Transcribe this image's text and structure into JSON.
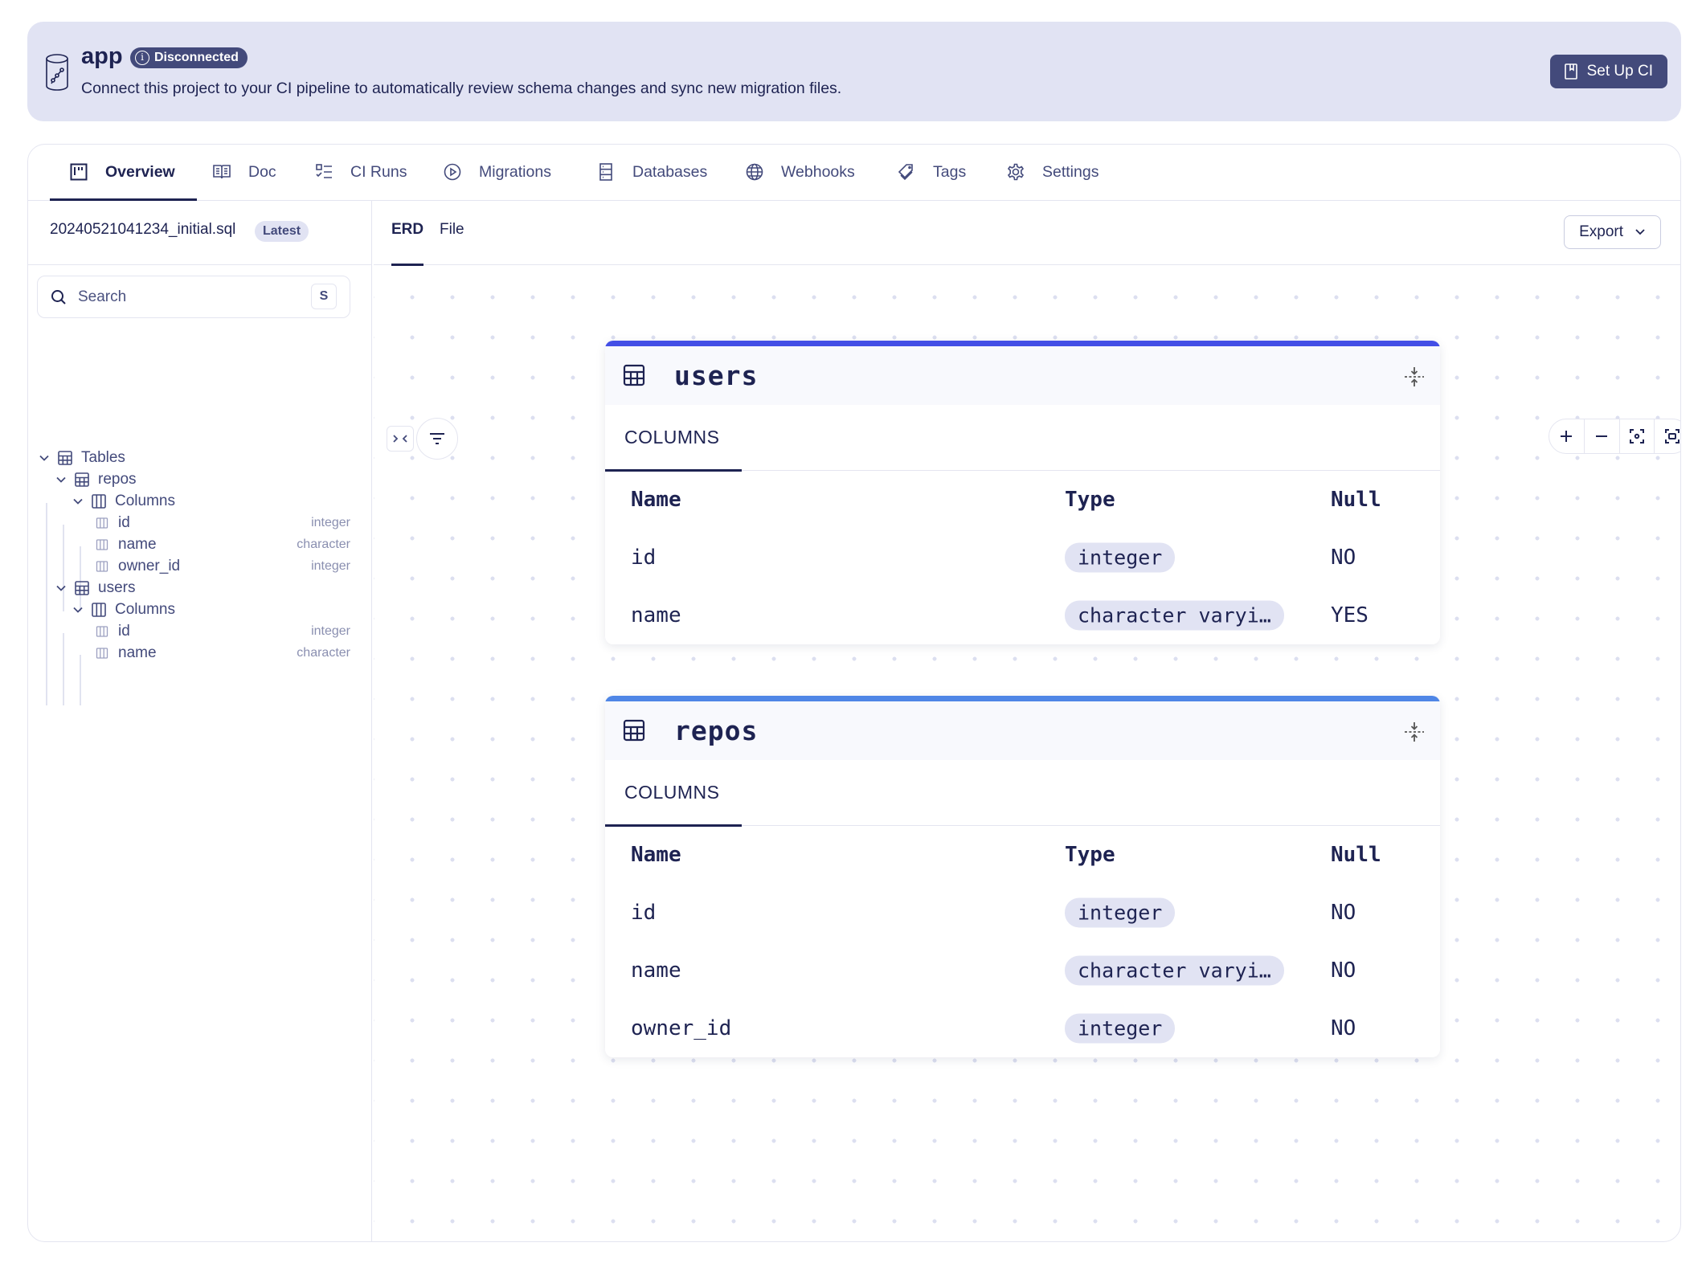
{
  "banner": {
    "project_name": "app",
    "status": "Disconnected",
    "description": "Connect this project to your CI pipeline to automatically review schema changes and sync new migration files.",
    "setup_button": "Set Up CI"
  },
  "tabs": [
    {
      "label": "Overview",
      "icon": "kanban-icon",
      "active": true
    },
    {
      "label": "Doc",
      "icon": "book-open-icon",
      "active": false
    },
    {
      "label": "CI Runs",
      "icon": "list-checks-icon",
      "active": false
    },
    {
      "label": "Migrations",
      "icon": "play-circle-icon",
      "active": false
    },
    {
      "label": "Databases",
      "icon": "server-icon",
      "active": false
    },
    {
      "label": "Webhooks",
      "icon": "globe-icon",
      "active": false
    },
    {
      "label": "Tags",
      "icon": "tags-icon",
      "active": false
    },
    {
      "label": "Settings",
      "icon": "gear-icon",
      "active": false
    }
  ],
  "sidebar": {
    "file_name": "20240521041234_initial.sql",
    "file_badge": "Latest",
    "search_placeholder": "Search",
    "search_shortcut": "S",
    "tree": {
      "root_label": "Tables",
      "tables": [
        {
          "name": "repos",
          "group_label": "Columns",
          "columns": [
            {
              "name": "id",
              "type": "integer"
            },
            {
              "name": "name",
              "type": "character"
            },
            {
              "name": "owner_id",
              "type": "integer"
            }
          ]
        },
        {
          "name": "users",
          "group_label": "Columns",
          "columns": [
            {
              "name": "id",
              "type": "integer"
            },
            {
              "name": "name",
              "type": "character"
            }
          ]
        }
      ]
    }
  },
  "content": {
    "subtabs": [
      {
        "label": "ERD",
        "active": true
      },
      {
        "label": "File",
        "active": false
      }
    ],
    "export_label": "Export",
    "zoom_controls": [
      "zoom-in",
      "zoom-out",
      "fit-view",
      "fullscreen"
    ]
  },
  "erd": {
    "tables": [
      {
        "name": "users",
        "accent": "#434fe6",
        "tab_label": "COLUMNS",
        "headers": {
          "name": "Name",
          "type": "Type",
          "null": "Null"
        },
        "columns": [
          {
            "name": "id",
            "type": "integer",
            "null": "NO"
          },
          {
            "name": "name",
            "type": "character varyi…",
            "null": "YES"
          }
        ]
      },
      {
        "name": "repos",
        "accent": "#4f86e6",
        "tab_label": "COLUMNS",
        "headers": {
          "name": "Name",
          "type": "Type",
          "null": "Null"
        },
        "columns": [
          {
            "name": "id",
            "type": "integer",
            "null": "NO"
          },
          {
            "name": "name",
            "type": "character varyi…",
            "null": "NO"
          },
          {
            "name": "owner_id",
            "type": "integer",
            "null": "NO"
          }
        ]
      }
    ]
  }
}
